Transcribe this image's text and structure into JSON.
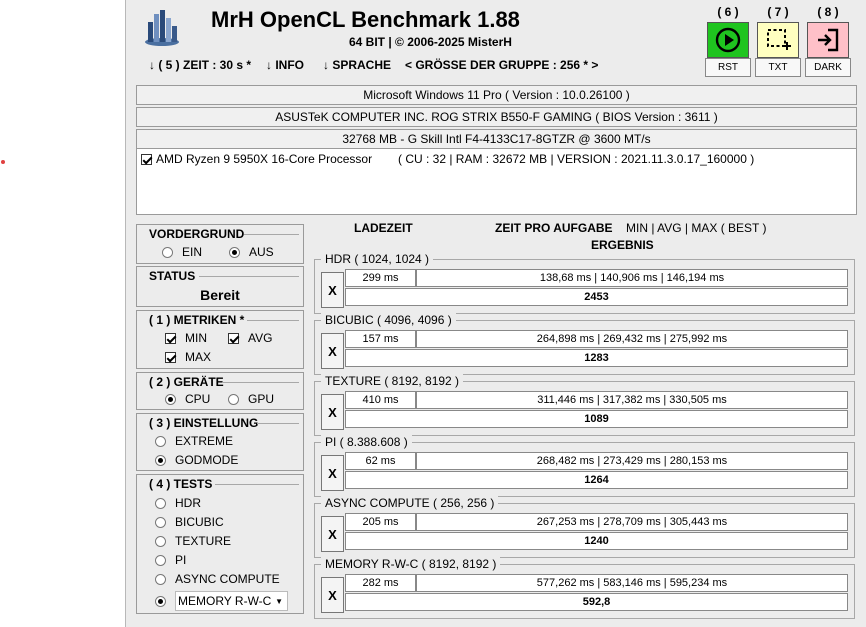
{
  "app": {
    "title": "MrH OpenCL Benchmark 1.88",
    "subtitle": "64 BIT | ©  2006-2025 MisterH"
  },
  "menu": [
    {
      "label": "↓ ( 5 ) ZEIT : 30 s *"
    },
    {
      "label": "↓ INFO"
    },
    {
      "label": "↓ SPRACHE"
    },
    {
      "label": "< GRÖSSE DER GRUPPE : 256 * >"
    }
  ],
  "toolbar": [
    {
      "hotkey": "( 6 )",
      "label": "RST",
      "icon": "play-icon",
      "color": "#1fc41f"
    },
    {
      "hotkey": "( 7 )",
      "label": "TXT",
      "icon": "selection-icon",
      "color": "#ffffc0"
    },
    {
      "hotkey": "( 8 )",
      "label": "DARK",
      "icon": "exit-icon",
      "color": "#ffc0c8"
    }
  ],
  "system": {
    "os": "Microsoft Windows 11 Pro ( Version : 10.0.26100 )",
    "board": "ASUSTeK COMPUTER INC. ROG STRIX B550-F GAMING ( BIOS Version : 3611 )",
    "memory": "32768 MB - G Skill Intl F4-4133C17-8GTZR @ 3600 MT/s",
    "device_name": "AMD Ryzen 9 5950X 16-Core Processor",
    "device_info": "( CU : 32 | RAM : 32672 MB | VERSION : 2021.11.3.0.17_160000 )",
    "device_checked": true
  },
  "panels": {
    "foreground": {
      "title": "VORDERGRUND",
      "options": [
        {
          "label": "EIN",
          "selected": false
        },
        {
          "label": "AUS",
          "selected": true
        }
      ]
    },
    "status": {
      "title": "STATUS",
      "value": "Bereit"
    },
    "metrics": {
      "title": "( 1 ) METRIKEN *",
      "options": [
        {
          "label": "MIN",
          "checked": true
        },
        {
          "label": "AVG",
          "checked": true
        },
        {
          "label": "MAX",
          "checked": true
        }
      ]
    },
    "devices": {
      "title": "( 2 ) GERÄTE",
      "options": [
        {
          "label": "CPU",
          "selected": true
        },
        {
          "label": "GPU",
          "selected": false
        }
      ]
    },
    "setting": {
      "title": "( 3 ) EINSTELLUNG",
      "options": [
        {
          "label": "EXTREME",
          "selected": false
        },
        {
          "label": "GODMODE",
          "selected": true
        }
      ]
    },
    "tests": {
      "title": "( 4 ) TESTS",
      "options": [
        {
          "label": "HDR",
          "selected": false
        },
        {
          "label": "BICUBIC",
          "selected": false
        },
        {
          "label": "TEXTURE",
          "selected": false
        },
        {
          "label": "PI",
          "selected": false
        },
        {
          "label": "ASYNC COMPUTE",
          "selected": false
        },
        {
          "label": "MEMORY R-W-C",
          "selected": true
        }
      ]
    }
  },
  "results_header": {
    "load_time": "LADEZEIT",
    "time_per_task": "ZEIT PRO AUFGABE",
    "metrics": "MIN | AVG | MAX ( BEST )",
    "result": "ERGEBNIS"
  },
  "results": [
    {
      "name": "HDR ( 1024, 1024 )",
      "x": "X",
      "load": "299 ms",
      "times": "138,68 ms | 140,906 ms | 146,194 ms",
      "score": "2453"
    },
    {
      "name": "BICUBIC ( 4096, 4096 )",
      "x": "X",
      "load": "157 ms",
      "times": "264,898 ms | 269,432 ms | 275,992 ms",
      "score": "1283"
    },
    {
      "name": "TEXTURE ( 8192, 8192 )",
      "x": "X",
      "load": "410 ms",
      "times": "311,446 ms | 317,382 ms | 330,505 ms",
      "score": "1089"
    },
    {
      "name": "PI ( 8.388.608 )",
      "x": "X",
      "load": "62 ms",
      "times": "268,482 ms | 273,429 ms | 280,153 ms",
      "score": "1264"
    },
    {
      "name": "ASYNC COMPUTE ( 256, 256 )",
      "x": "X",
      "load": "205 ms",
      "times": "267,253 ms | 278,709 ms | 305,443 ms",
      "score": "1240"
    },
    {
      "name": "MEMORY R-W-C ( 8192, 8192 )",
      "x": "X",
      "load": "282 ms",
      "times": "577,262 ms | 583,146 ms | 595,234 ms",
      "score": "592,8"
    }
  ]
}
